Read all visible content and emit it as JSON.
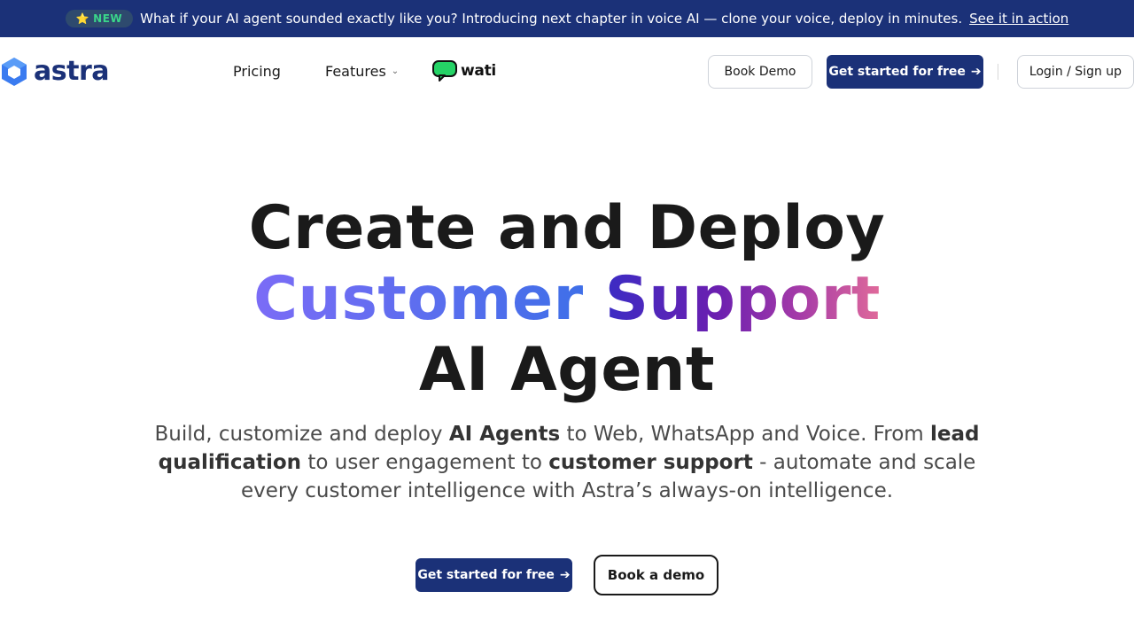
{
  "announcement": {
    "badge_star": "⭐",
    "badge_label": "NEW",
    "text": "What if your AI agent sounded exactly like you? Introducing next chapter in voice AI — clone your voice, deploy in minutes.",
    "link": "See it in action"
  },
  "nav": {
    "logo_text": "astra",
    "links": {
      "pricing": "Pricing",
      "features": "Features"
    },
    "partner": "wati",
    "book_demo": "Book Demo",
    "get_started": "Get started for free",
    "login": "Login / Sign up"
  },
  "hero": {
    "line1": "Create and Deploy",
    "line2a": "Customer",
    "line2b": "Support",
    "line3": "AI Agent",
    "sub": {
      "p1": "Build, customize and deploy ",
      "b1": "AI Agents",
      "p2": " to Web, WhatsApp and Voice. From ",
      "b2": "lead qualification",
      "p3": " to user engagement to ",
      "b3": "customer support",
      "p4": " - automate and scale every customer intelligence with Astra’s always-on intelligence."
    },
    "cta_primary": "Get started for free",
    "cta_secondary": "Book a demo"
  },
  "colors": {
    "brand": "#1b3178",
    "badge_text": "#3ad68a",
    "wati_green": "#25d366"
  },
  "icons": [
    "star-icon",
    "astra-logo-icon",
    "chevron-down-icon",
    "wati-chat-icon",
    "arrow-right-icon"
  ]
}
